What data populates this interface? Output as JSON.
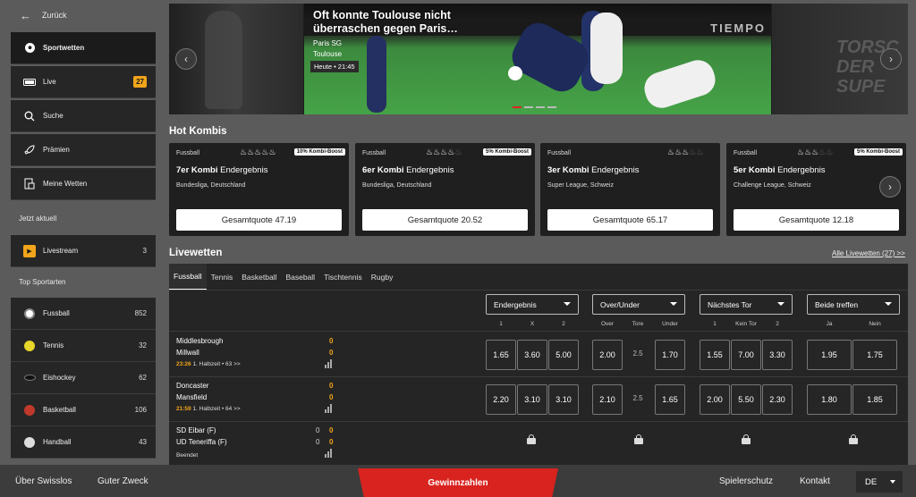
{
  "sidebar": {
    "back_label": "Zurück",
    "items": [
      {
        "label": "Sportwetten",
        "icon": "soccer-ball-icon"
      },
      {
        "label": "Live",
        "icon": "live-icon",
        "badge": "27"
      },
      {
        "label": "Suche",
        "icon": "search-icon"
      },
      {
        "label": "Prämien",
        "icon": "rocket-icon"
      },
      {
        "label": "Meine Wetten",
        "icon": "bet-slip-icon"
      }
    ],
    "section_now": "Jetzt aktuell",
    "livestream": {
      "label": "Livestream",
      "count": "3"
    },
    "section_top": "Top Sportarten",
    "sports": [
      {
        "label": "Fussball",
        "count": "852",
        "color": "#ffffff"
      },
      {
        "label": "Tennis",
        "count": "32",
        "color": "#e8d62a"
      },
      {
        "label": "Eishockey",
        "count": "62",
        "color": "#222222"
      },
      {
        "label": "Basketball",
        "count": "106",
        "color": "#c0392b"
      },
      {
        "label": "Handball",
        "count": "43",
        "color": "#dddddd"
      }
    ]
  },
  "banner": {
    "title": "Oft konnte Toulouse nicht überraschen gegen Paris…",
    "team1": "Paris SG",
    "team2": "Toulouse",
    "time": "Heute • 21:45",
    "stadium_board": "TIEMPO",
    "right_text": "TORSC DER SUPE"
  },
  "hot_kombis": {
    "title": "Hot Kombis",
    "cards": [
      {
        "sport": "Fussball",
        "flames_on": 5,
        "boost": "10% Kombi-Boost",
        "title_bold": "7er Kombi",
        "title_rest": "Endergebnis",
        "league": "Bundesliga, Deutschland",
        "quote": "Gesamtquote 47.19"
      },
      {
        "sport": "Fussball",
        "flames_on": 4,
        "boost": "5% Kombi-Boost",
        "title_bold": "6er Kombi",
        "title_rest": "Endergebnis",
        "league": "Bundesliga, Deutschland",
        "quote": "Gesamtquote 20.52"
      },
      {
        "sport": "Fussball",
        "flames_on": 3,
        "boost": "",
        "title_bold": "3er Kombi",
        "title_rest": "Endergebnis",
        "league": "Super League, Schweiz",
        "quote": "Gesamtquote 65.17"
      },
      {
        "sport": "Fussball",
        "flames_on": 3,
        "boost": "5% Kombi-Boost",
        "title_bold": "5er Kombi",
        "title_rest": "Endergebnis",
        "league": "Challenge League, Schweiz",
        "quote": "Gesamtquote 12.18"
      }
    ]
  },
  "live": {
    "title": "Livewetten",
    "all_link": "Alle Livewetten (27) >>",
    "tabs": [
      "Fussball",
      "Tennis",
      "Basketball",
      "Baseball",
      "Tischtennis",
      "Rugby"
    ],
    "markets": [
      {
        "label": "Endergebnis",
        "cols": [
          "1",
          "X",
          "2"
        ]
      },
      {
        "label": "Over/Under",
        "cols": [
          "Over",
          "Tore",
          "Under"
        ]
      },
      {
        "label": "Nächstes Tor",
        "cols": [
          "1",
          "Kein Tor",
          "2"
        ]
      },
      {
        "label": "Beide treffen",
        "cols": [
          "Ja",
          "Nein"
        ]
      }
    ],
    "matches": [
      {
        "home": "Middlesbrough",
        "away": "Millwall",
        "score_home": "0",
        "score_away": "0",
        "minute": "23:26",
        "period": "1. Halbzeit • 63 >>",
        "odds": [
          "1.65",
          "3.60",
          "5.00",
          "2.00",
          "2.5",
          "1.70",
          "1.55",
          "7.00",
          "3.30",
          "1.95",
          "1.75"
        ]
      },
      {
        "home": "Doncaster",
        "away": "Mansfield",
        "score_home": "0",
        "score_away": "0",
        "minute": "21:59",
        "period": "1. Halbzeit • 64 >>",
        "odds": [
          "2.20",
          "3.10",
          "3.10",
          "2.10",
          "2.5",
          "1.65",
          "2.00",
          "5.50",
          "2.30",
          "1.80",
          "1.85"
        ]
      },
      {
        "home": "SD Eibar (F)",
        "away": "UD Teneriffa (F)",
        "set_home": "0",
        "set_away": "0",
        "score_home": "0",
        "score_away": "0",
        "status": "Beendet"
      }
    ]
  },
  "footer": {
    "links": [
      "Über Swisslos",
      "Guter Zweck",
      "Spielerschutz",
      "Kontakt"
    ],
    "cta": "Gewinnzahlen",
    "lang": "DE"
  },
  "colors": {
    "accent": "#f2a51a",
    "cta": "#d8231f",
    "background": "#5b5b5b",
    "panel": "#252525"
  }
}
